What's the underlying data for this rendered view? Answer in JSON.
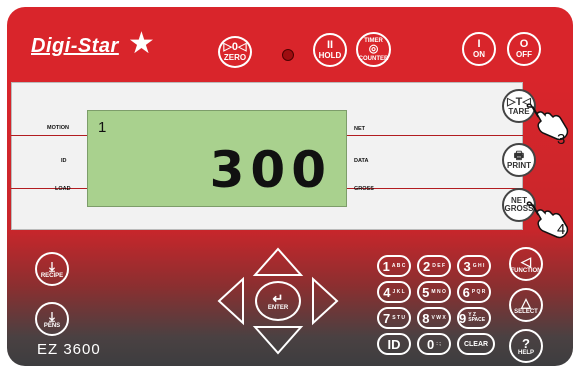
{
  "brand": "Digi-Star",
  "model": "EZ 3600",
  "display": {
    "step_number": "1",
    "value": "300"
  },
  "left_labels": {
    "motion": "MOTION",
    "id": "ID",
    "load": "LOAD"
  },
  "right_labels": {
    "net": "NET",
    "data": "DATA",
    "gross": "GROSS"
  },
  "top_buttons": {
    "zero": {
      "symbol": "▷0◁",
      "label": "ZERO"
    },
    "hold": {
      "symbol": "II",
      "label": "HOLD"
    },
    "timer": {
      "symbol": "TIMER",
      "label": "COUNTER"
    },
    "on": {
      "symbol": "I",
      "label": "ON"
    },
    "off": {
      "symbol": "O",
      "label": "OFF"
    }
  },
  "panel_buttons": {
    "tare": {
      "symbol": "▷T◁",
      "label": "TARE"
    },
    "print": {
      "label": "PRINT"
    },
    "net_gross": {
      "top": "NET",
      "bottom": "GROSS"
    }
  },
  "pointers": {
    "tare_step": "3",
    "net_step": "4"
  },
  "left_buttons": {
    "recipe": "RECIPE",
    "pens": "PENS"
  },
  "nav": {
    "enter": "ENTER"
  },
  "keys": [
    {
      "main": "1",
      "sub": "A B C"
    },
    {
      "main": "2",
      "sub": "D E F"
    },
    {
      "main": "3",
      "sub": "G H I"
    },
    {
      "main": "4",
      "sub": "J K L"
    },
    {
      "main": "5",
      "sub": "M N O"
    },
    {
      "main": "6",
      "sub": "P Q R"
    },
    {
      "main": "7",
      "sub": "S T U"
    },
    {
      "main": "8",
      "sub": "V W X"
    },
    {
      "main": "9",
      "sub": "Y Z SPACE"
    },
    {
      "main": "ID",
      "sub": ""
    },
    {
      "main": "0",
      "sub": ": ;"
    },
    {
      "main": "CLEAR",
      "sub": ""
    }
  ],
  "right_buttons": {
    "function": "FUNCTION",
    "select": "SELECT",
    "help": "HELP"
  },
  "colors": {
    "body_red": "#d9252b",
    "lcd_green": "#a9d18e",
    "panel": "#f2f2f2"
  }
}
